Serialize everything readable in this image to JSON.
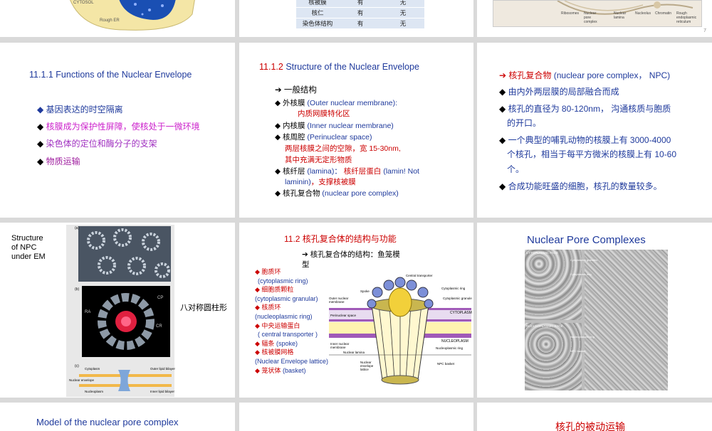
{
  "slide_top_left": {
    "cytosol": "CYTOSOL",
    "rough_er": "Rough ER"
  },
  "slide_top_mid": {
    "rows": [
      [
        "核被膜",
        "有",
        "无"
      ],
      [
        "核仁",
        "有",
        "无"
      ],
      [
        "染色体结构",
        "有",
        "无"
      ]
    ]
  },
  "slide_top_right": {
    "labels": [
      "Ribosomes",
      "Nuclear pore complex",
      "Nuclear lamina",
      "Nucleolus",
      "Chromatin",
      "Rough endoplasmic reticulum"
    ],
    "page": "7"
  },
  "slide_functions": {
    "title": "11.1.1  Functions of the Nuclear Envelope",
    "items": [
      "基因表达的时空隔离",
      "核膜成为保护性屏障，使核处于一微环境",
      "染色体的定位和酶分子的支架",
      "物质运输"
    ]
  },
  "slide_structure": {
    "title_num": "11.1.2",
    "title_text": "Structure of the Nuclear Envelope",
    "general": "一般结构",
    "l1a": "外核膜",
    "l1b": "(Outer nuclear membrane):",
    "l1c": "内质网膜特化区",
    "l2a": "内核膜",
    "l2b": "(Inner nuclear membrane)",
    "l3a": "核周腔",
    "l3b": "(Perinuclear space)",
    "l3c": "两层核膜之间的空隙，宽 15-30nm,",
    "l3d": "其中充满无定形物质",
    "l4a": "核纤层",
    "l4b": "(lamina)：",
    "l4c": "核纤层蛋白",
    "l4d": "(lamin! Not",
    "l4e": "laminin)",
    "l4f": "，支撑核被膜",
    "l5a": "核孔复合物",
    "l5b": "(nuclear pore complex)"
  },
  "slide_npc": {
    "l1a": "核孔复合物",
    "l1b": "(nuclear pore complex，  NPC)",
    "l2": "由内外两层膜的局部融合而成",
    "l3": "核孔的直径为 80-120nm， 沟通核质与胞质",
    "l3b": "的开口。",
    "l4": "一个典型的哺乳动物的核膜上有 3000-4000",
    "l4b": "个核孔，相当于每平方微米的核膜上有 10-60",
    "l4c": "个。",
    "l5": "合成功能旺盛的细胞，核孔的数量较多。"
  },
  "slide_em": {
    "title_l1": "Structure",
    "title_l2": "of NPC",
    "title_l3": "under EM",
    "caption": "八对称圆柱形",
    "label_a": "(a)",
    "label_b": "(b)",
    "label_c": "(c)",
    "ra": "RA",
    "cp": "CP",
    "cr": "CR",
    "cytoplasm": "Cytoplasm",
    "nucleoplasm": "Nucleoplasm",
    "nuclear_envelope": "Nuclear envelope",
    "outer_lipid": "Outer lipid bilayer",
    "inner_lipid": "Inner lipid bilayer"
  },
  "slide_fn": {
    "title": "11.2  核孔复合体的结构与功能",
    "sub1": "核孔复合体的结构：鱼笼模",
    "sub2": "型",
    "items": [
      {
        "cn": "胞质环",
        "en": "(cytoplasmic ring)"
      },
      {
        "cn": "细胞质颗粒",
        "en": "(cytoplasmic granular)"
      },
      {
        "cn": "核质环",
        "en": "(nucleoplasmic ring)"
      },
      {
        "cn": "中央运输蛋白",
        "en": "( central transporter )"
      },
      {
        "cn": "辐条",
        "en": "(spoke)"
      },
      {
        "cn": "核被膜网格",
        "en": "(Nuclear Envelope lattice)"
      },
      {
        "cn": "笼状体",
        "en": "(basket)"
      }
    ],
    "diagram_labels": {
      "central": "Central transporter",
      "spoke": "Spoke",
      "cyto_ring": "Cytoplasmic ring",
      "cyto_gran": "Cytoplasmic granule",
      "outer": "Outer nuclear membrane",
      "peri": "Perinuclear space",
      "cytoplasm": "CYTOPLASM",
      "nucleoplasm": "NUCLEOPLASM",
      "inner": "Inner nuclear membrane",
      "lamina": "Nuclear lamina",
      "lattice": "Nuclear envelope lattice",
      "nuc_ring": "Nucleoplasmic ring",
      "basket": "NPC basket"
    }
  },
  "slide_complexes": {
    "title": "Nuclear Pore Complexes",
    "face1": "CYTOPLASMIC FACE",
    "face2": "NUCLEOPLASMIC FACE",
    "side1": "Cytoplasmic granules",
    "side2": "Cytoplasmic ring",
    "side3": "Nucleoplasmic ring",
    "side4": "NPC basket"
  },
  "slide_bottom_left": {
    "title": "Model of the nuclear pore complex"
  },
  "slide_bottom_right": {
    "title": "核孔的被动运输"
  }
}
